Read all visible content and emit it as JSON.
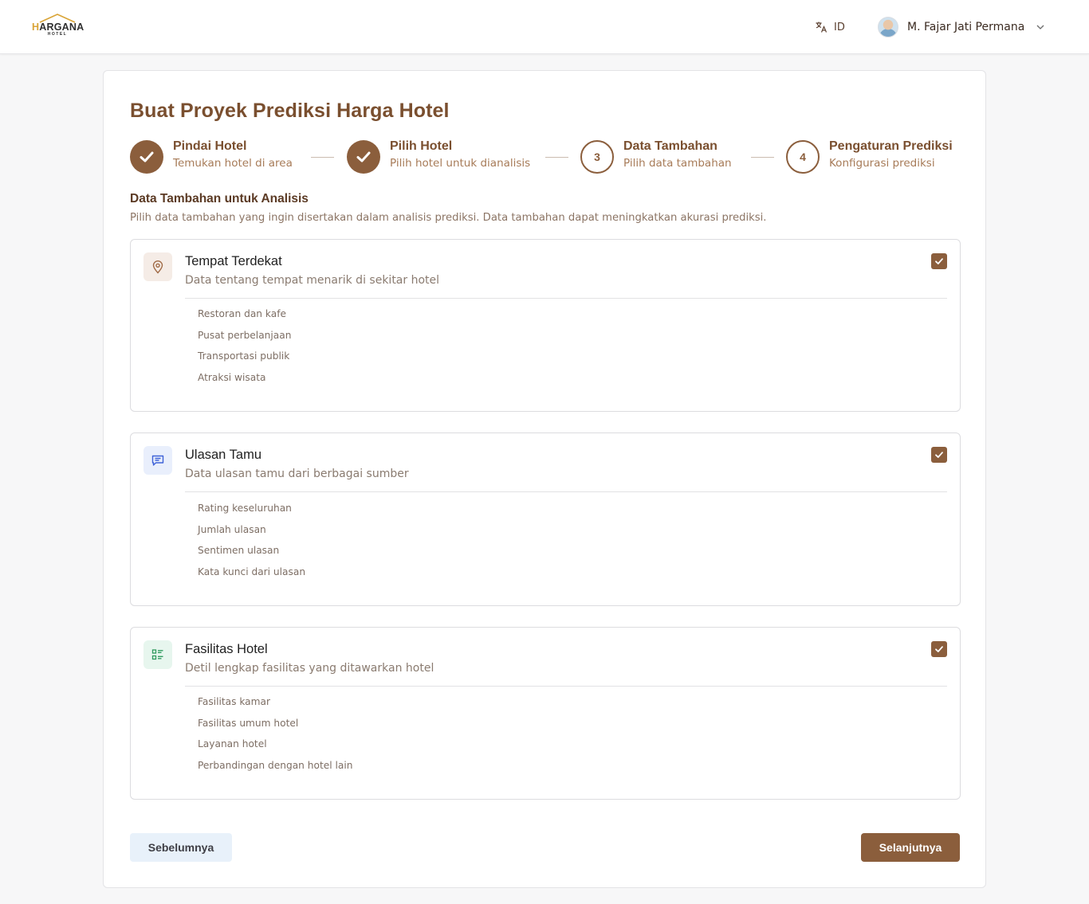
{
  "header": {
    "logo_word_first": "H",
    "logo_word_rest": "ARGANA",
    "logo_sub": "HOTEL",
    "language": "ID",
    "user_name": "M. Fajar Jati Permana"
  },
  "page": {
    "title": "Buat Proyek Prediksi Harga Hotel"
  },
  "stepper": {
    "steps": [
      {
        "number": "1",
        "title": "Pindai Hotel",
        "subtitle": "Temukan hotel di area",
        "status": "done"
      },
      {
        "number": "2",
        "title": "Pilih Hotel",
        "subtitle": "Pilih hotel untuk dianalisis",
        "status": "done"
      },
      {
        "number": "3",
        "title": "Data Tambahan",
        "subtitle": "Pilih data tambahan",
        "status": "current"
      },
      {
        "number": "4",
        "title": "Pengaturan Prediksi",
        "subtitle": "Konfigurasi prediksi",
        "status": "todo"
      }
    ]
  },
  "section": {
    "title": "Data Tambahan untuk Analisis",
    "description": "Pilih data tambahan yang ingin disertakan dalam analisis prediksi. Data tambahan dapat meningkatkan akurasi prediksi."
  },
  "options": [
    {
      "icon": "map-pin-icon",
      "title": "Tempat Terdekat",
      "description": "Data tentang tempat menarik di sekitar hotel",
      "checked": true,
      "items": [
        "Restoran dan kafe",
        "Pusat perbelanjaan",
        "Transportasi publik",
        "Atraksi wisata"
      ]
    },
    {
      "icon": "chat-message-icon",
      "title": "Ulasan Tamu",
      "description": "Data ulasan tamu dari berbagai sumber",
      "checked": true,
      "items": [
        "Rating keseluruhan",
        "Jumlah ulasan",
        "Sentimen ulasan",
        "Kata kunci dari ulasan"
      ]
    },
    {
      "icon": "list-details-icon",
      "title": "Fasilitas Hotel",
      "description": "Detil lengkap fasilitas yang ditawarkan hotel",
      "checked": true,
      "items": [
        "Fasilitas kamar",
        "Fasilitas umum hotel",
        "Layanan hotel",
        "Perbandingan dengan hotel lain"
      ]
    }
  ],
  "footer": {
    "prev_label": "Sebelumnya",
    "next_label": "Selanjutnya"
  },
  "colors": {
    "brand_brown": "#8b5e3c",
    "logo_gold": "#d9a437",
    "secondary_button_bg": "#e8f1fa"
  }
}
